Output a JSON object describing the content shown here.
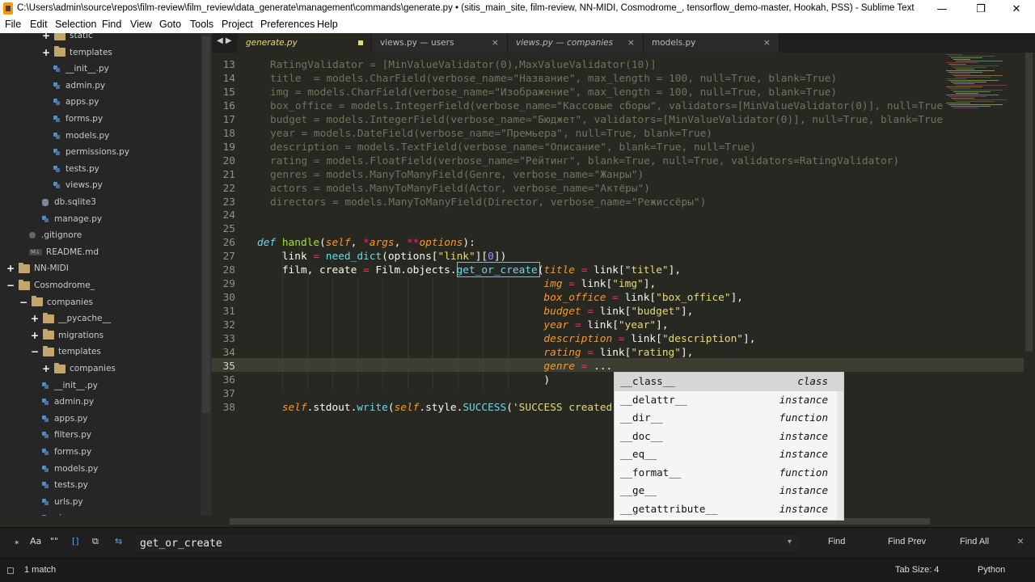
{
  "window": {
    "title": "C:\\Users\\admin\\source\\repos\\film-review\\film_review\\data_generate\\management\\commands\\generate.py • (sitis_main_site, film-review, NN-MIDI, Cosmodrome_, tensorflow_demo-master, Hookah, PSS) - Sublime Text",
    "minimize_glyph": "—",
    "maximize_glyph": "❐",
    "close_glyph": "✕"
  },
  "menu": [
    "File",
    "Edit",
    "Selection",
    "Find",
    "View",
    "Goto",
    "Tools",
    "Project",
    "Preferences",
    "Help"
  ],
  "sidebar": {
    "items": [
      {
        "label": "static",
        "icon": "folder-icon",
        "expander": "+"
      },
      {
        "label": "templates",
        "icon": "folder-icon",
        "expander": "+"
      },
      {
        "label": "__init__.py",
        "icon": "python-file-icon"
      },
      {
        "label": "admin.py",
        "icon": "python-file-icon"
      },
      {
        "label": "apps.py",
        "icon": "python-file-icon"
      },
      {
        "label": "forms.py",
        "icon": "python-file-icon"
      },
      {
        "label": "models.py",
        "icon": "python-file-icon"
      },
      {
        "label": "permissions.py",
        "icon": "python-file-icon"
      },
      {
        "label": "tests.py",
        "icon": "python-file-icon"
      },
      {
        "label": "views.py",
        "icon": "python-file-icon"
      },
      {
        "label": "db.sqlite3",
        "icon": "database-file-icon"
      },
      {
        "label": "manage.py",
        "icon": "python-file-icon"
      },
      {
        "label": ".gitignore",
        "icon": "git-file-icon"
      },
      {
        "label": "README.md",
        "icon": "markdown-file-icon",
        "badge": "M↓"
      },
      {
        "label": "NN-MIDI",
        "icon": "folder-icon",
        "expander": "+"
      },
      {
        "label": "Cosmodrome_",
        "icon": "folder-icon",
        "expander": "−"
      },
      {
        "label": "companies",
        "icon": "folder-icon",
        "expander": "−"
      },
      {
        "label": "__pycache__",
        "icon": "folder-icon",
        "expander": "+"
      },
      {
        "label": "migrations",
        "icon": "folder-icon",
        "expander": "+"
      },
      {
        "label": "templates",
        "icon": "folder-icon",
        "expander": "−"
      },
      {
        "label": "companies",
        "icon": "folder-icon",
        "expander": "+"
      },
      {
        "label": "__init__.py",
        "icon": "python-file-icon"
      },
      {
        "label": "admin.py",
        "icon": "python-file-icon"
      },
      {
        "label": "apps.py",
        "icon": "python-file-icon"
      },
      {
        "label": "filters.py",
        "icon": "python-file-icon"
      },
      {
        "label": "forms.py",
        "icon": "python-file-icon"
      },
      {
        "label": "models.py",
        "icon": "python-file-icon"
      },
      {
        "label": "tests.py",
        "icon": "python-file-icon"
      },
      {
        "label": "urls.py",
        "icon": "python-file-icon"
      },
      {
        "label": "views.py",
        "icon": "python-file-icon"
      }
    ]
  },
  "tabs": [
    {
      "label": "generate.py",
      "active": true,
      "dirty": true
    },
    {
      "label": "views.py — users",
      "close": "×"
    },
    {
      "label": "views.py — companies",
      "close": "×"
    },
    {
      "label": "models.py",
      "close": "×"
    }
  ],
  "tab_nav": "◀ ▶",
  "editor": {
    "current_line": 35,
    "lines": [
      {
        "n": 13,
        "text": "RatingValidator = [MinValueValidator(0),MaxValueValidator(10)]"
      },
      {
        "n": 14,
        "text": "title  = models.CharField(verbose_name=\"Название\", max_length = 100, null=True, blank=True)"
      },
      {
        "n": 15,
        "text": "img = models.CharField(verbose_name=\"Изображение\", max_length = 100, null=True, blank=True)"
      },
      {
        "n": 16,
        "text": "box_office = models.IntegerField(verbose_name=\"Кассовые сборы\", validators=[MinValueValidator(0)], null=True"
      },
      {
        "n": 17,
        "text": "budget = models.IntegerField(verbose_name=\"Бюджет\", validators=[MinValueValidator(0)], null=True, blank=True"
      },
      {
        "n": 18,
        "text": "year = models.DateField(verbose_name=\"Премьера\", null=True, blank=True)"
      },
      {
        "n": 19,
        "text": "description = models.TextField(verbose_name=\"Описание\", blank=True, null=True)"
      },
      {
        "n": 20,
        "text": "rating = models.FloatField(verbose_name=\"Рейтинг\", blank=True, null=True, validators=RatingValidator)"
      },
      {
        "n": 21,
        "text": "genres = models.ManyToManyField(Genre, verbose_name=\"Жанры\")"
      },
      {
        "n": 22,
        "text": "actors = models.ManyToManyField(Actor, verbose_name=\"Актёры\")"
      },
      {
        "n": 23,
        "text": "directors = models.ManyToManyField(Director, verbose_name=\"Режиссёры\")"
      },
      {
        "n": 24,
        "text": ""
      },
      {
        "n": 25,
        "text": ""
      },
      {
        "n": 26,
        "text": ""
      },
      {
        "n": 27,
        "text": ""
      },
      {
        "n": 28,
        "text": ""
      },
      {
        "n": 29,
        "text": ""
      },
      {
        "n": 30,
        "text": ""
      },
      {
        "n": 31,
        "text": ""
      },
      {
        "n": 32,
        "text": ""
      },
      {
        "n": 33,
        "text": ""
      },
      {
        "n": 34,
        "text": ""
      },
      {
        "n": 35,
        "text": ""
      },
      {
        "n": 36,
        "text": ""
      },
      {
        "n": 37,
        "text": ""
      },
      {
        "n": 38,
        "text": ""
      }
    ]
  },
  "autocomplete": {
    "items": [
      {
        "name": "__class__",
        "kind": "class"
      },
      {
        "name": "__delattr__",
        "kind": "instance"
      },
      {
        "name": "__dir__",
        "kind": "function"
      },
      {
        "name": "__doc__",
        "kind": "instance"
      },
      {
        "name": "__eq__",
        "kind": "instance"
      },
      {
        "name": "__format__",
        "kind": "function"
      },
      {
        "name": "__ge__",
        "kind": "instance"
      },
      {
        "name": "__getattribute__",
        "kind": "instance"
      }
    ]
  },
  "find": {
    "query": "get_or_create",
    "options": [
      "⁎",
      "Aa",
      "\"\"",
      "[]",
      "⧉",
      "⇆"
    ],
    "dropdown_glyph": "▾",
    "buttons": {
      "find": "Find",
      "find_prev": "Find Prev",
      "find_all": "Find All"
    },
    "close_glyph": "×"
  },
  "status": {
    "matches": "1 match",
    "tab_size": "Tab Size: 4",
    "syntax": "Python"
  }
}
